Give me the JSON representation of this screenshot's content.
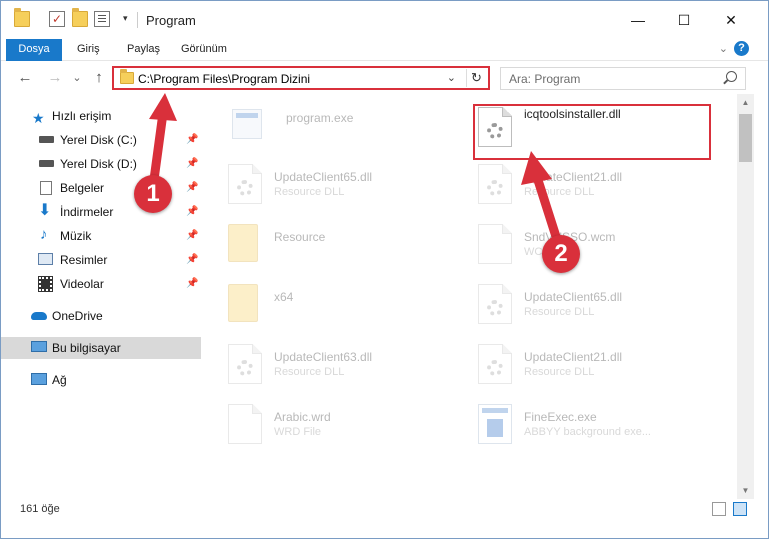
{
  "window": {
    "title": "Program",
    "minimize": "—",
    "maximize": "☐",
    "close": "✕"
  },
  "ribbon": {
    "tabs": [
      "Dosya",
      "Giriş",
      "Paylaş",
      "Görünüm"
    ],
    "help": "?"
  },
  "nav": {
    "back": "←",
    "forward": "→",
    "recent": "⌄",
    "up": "↑",
    "address": "C:\\Program Files\\Program Dizini",
    "refresh": "↻",
    "search_placeholder": "Ara: Program"
  },
  "sidebar": {
    "quick_access": "Hızlı erişim",
    "items": [
      {
        "label": "Yerel Disk (C:)",
        "icon": "drive-icon",
        "pinned": true
      },
      {
        "label": "Yerel Disk (D:)",
        "icon": "drive-icon",
        "pinned": true
      },
      {
        "label": "Belgeler",
        "icon": "documents-icon",
        "pinned": true
      },
      {
        "label": "İndirmeler",
        "icon": "downloads-icon",
        "pinned": true
      },
      {
        "label": "Müzik",
        "icon": "music-icon",
        "pinned": true
      },
      {
        "label": "Resimler",
        "icon": "pictures-icon",
        "pinned": true
      },
      {
        "label": "Videolar",
        "icon": "videos-icon",
        "pinned": true
      }
    ],
    "onedrive": "OneDrive",
    "this_pc": "Bu bilgisayar",
    "network": "Ağ"
  },
  "files": [
    {
      "name": "program.exe",
      "type": "",
      "icon": "exe-icon",
      "faded": true
    },
    {
      "name": "icqtoolsinstaller.dll",
      "type": "",
      "icon": "dll-icon",
      "faded": false
    },
    {
      "name": "UpdateClient65.dll",
      "type": "Resource DLL",
      "icon": "dll-icon",
      "faded": true
    },
    {
      "name": "UpdateClient21.dll",
      "type": "Resource DLL",
      "icon": "dll-icon",
      "faded": true
    },
    {
      "name": "Resource",
      "type": "",
      "icon": "folder-icon",
      "faded": true
    },
    {
      "name": "SndVolSSO.wcm",
      "type": "WCM File",
      "icon": "file-icon",
      "faded": true
    },
    {
      "name": "x64",
      "type": "",
      "icon": "folder-icon",
      "faded": true
    },
    {
      "name": "UpdateClient65.dll",
      "type": "Resource DLL",
      "icon": "dll-icon",
      "faded": true
    },
    {
      "name": "UpdateClient63.dll",
      "type": "Resource DLL",
      "icon": "dll-icon",
      "faded": true
    },
    {
      "name": "UpdateClient21.dll",
      "type": "Resource DLL",
      "icon": "dll-icon",
      "faded": true
    },
    {
      "name": "Arabic.wrd",
      "type": "WRD File",
      "icon": "file-icon",
      "faded": true
    },
    {
      "name": "FineExec.exe",
      "type": "ABBYY background exe...",
      "icon": "exe-icon",
      "faded": true
    }
  ],
  "status": {
    "count": "161 öğe"
  },
  "annotations": [
    "1",
    "2"
  ],
  "colors": {
    "accent": "#1979ca",
    "annotation": "#d9303b"
  }
}
